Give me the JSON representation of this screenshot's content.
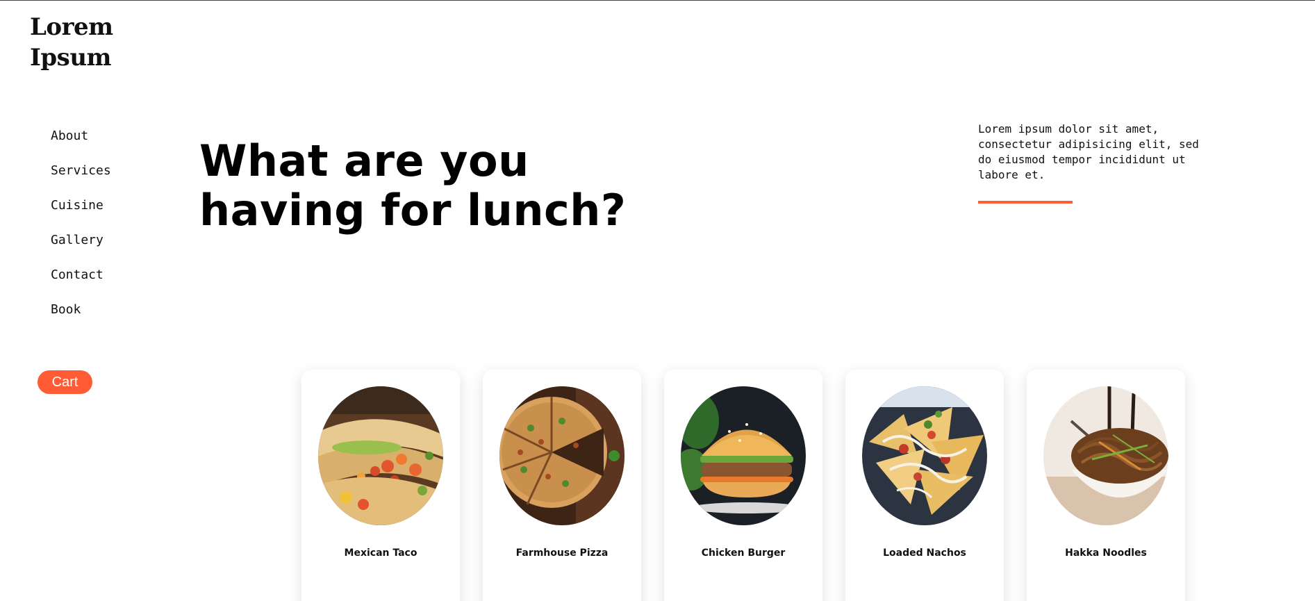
{
  "brand": {
    "line1": "Lorem",
    "line2": "Ipsum"
  },
  "nav": {
    "items": [
      {
        "label": "About"
      },
      {
        "label": "Services"
      },
      {
        "label": "Cuisine"
      },
      {
        "label": "Gallery"
      },
      {
        "label": "Contact"
      },
      {
        "label": "Book"
      }
    ]
  },
  "cart": {
    "label": "Cart"
  },
  "hero": {
    "line1": "What are you",
    "line2": "having for lunch?",
    "intro": "Lorem ipsum dolor sit amet, consectetur adipisicing elit, sed do eiusmod tempor incididunt ut labore et."
  },
  "menu": {
    "cards": [
      {
        "name": "Mexican Taco",
        "image": "taco-photo"
      },
      {
        "name": "Farmhouse Pizza",
        "image": "pizza-photo"
      },
      {
        "name": "Chicken Burger",
        "image": "burger-photo"
      },
      {
        "name": "Loaded Nachos",
        "image": "nachos-photo"
      },
      {
        "name": "Hakka Noodles",
        "image": "noodles-photo"
      }
    ]
  },
  "colors": {
    "accent": "#ff5b35",
    "text": "#111111",
    "background": "#ffffff"
  }
}
